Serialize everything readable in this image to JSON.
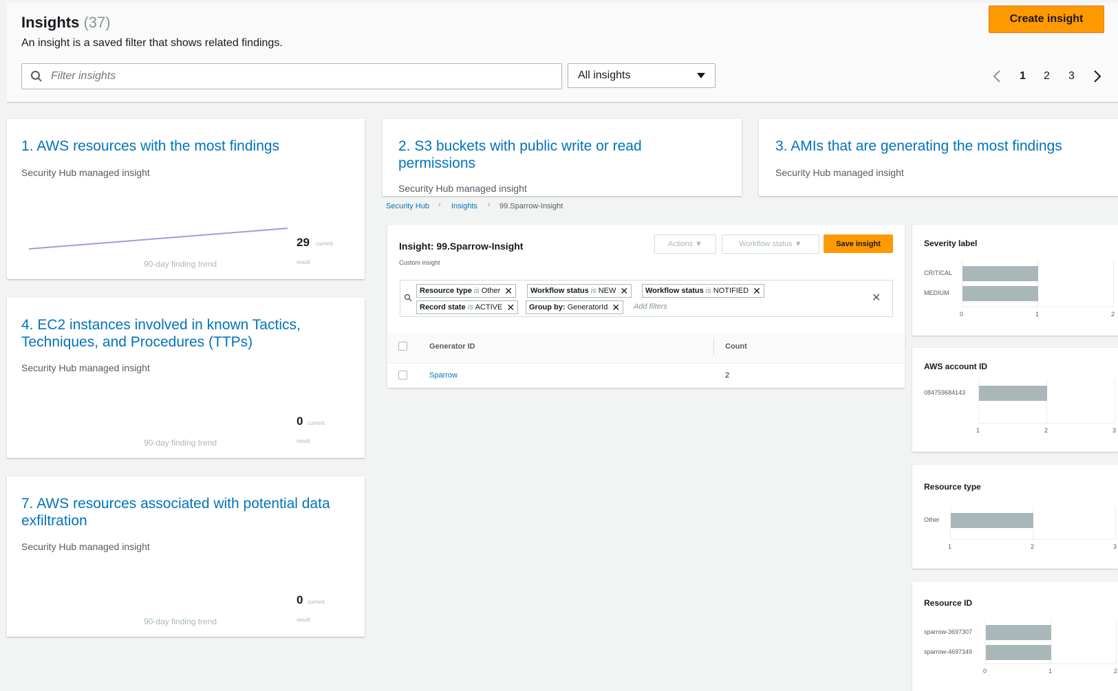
{
  "header": {
    "title": "Insights",
    "count": "(37)",
    "description": "An insight is a saved filter that shows related findings.",
    "create_button": "Create insight",
    "filter_placeholder": "Filter insights",
    "select_value": "All insights",
    "pages": [
      "1",
      "2",
      "3"
    ],
    "current_page": "1"
  },
  "cards": [
    {
      "title": "1. AWS resources with the most findings",
      "subtitle": "Security Hub managed insight",
      "count": "29",
      "count_label_top": "current",
      "count_label_bottom": "result",
      "trend_label": "90-day finding trend"
    },
    {
      "title": "2. S3 buckets with public write or read permissions",
      "subtitle": "Security Hub managed insight"
    },
    {
      "title": "3. AMIs that are generating the most findings",
      "subtitle": "Security Hub managed insight"
    },
    {
      "title": "4. EC2 instances involved in known Tactics, Techniques, and Procedures (TTPs)",
      "subtitle": "Security Hub managed insight",
      "count": "0",
      "count_label_top": "current",
      "count_label_bottom": "result",
      "trend_label": "90-day finding trend"
    },
    {
      "title": "7. AWS resources associated with potential data exfiltration",
      "subtitle": "Security Hub managed insight",
      "count": "0",
      "count_label_top": "current",
      "count_label_bottom": "result",
      "trend_label": "90-day finding trend"
    }
  ],
  "breadcrumb": {
    "items": [
      "Security Hub",
      "Insights",
      "99.Sparrow-Insight"
    ]
  },
  "insight_panel": {
    "title": "Insight: 99.Sparrow-Insight",
    "subtitle": "Custom insight",
    "actions_button": "Actions",
    "workflow_button": "Workflow status",
    "save_button": "Save insight",
    "filters": [
      {
        "key": "Resource type",
        "op": "is",
        "value": "Other"
      },
      {
        "key": "Workflow status",
        "op": "is",
        "value": "NEW"
      },
      {
        "key": "Workflow status",
        "op": "is",
        "value": "NOTIFIED"
      },
      {
        "key": "Record state",
        "op": "is",
        "value": "ACTIVE"
      },
      {
        "key": "Group by:",
        "op": "",
        "value": "GeneratorId"
      }
    ],
    "add_filters_placeholder": "Add filters",
    "columns": [
      "Generator ID",
      "Count"
    ],
    "rows": [
      {
        "generator_id": "Sparrow",
        "count": "2"
      }
    ]
  },
  "chart_data": [
    {
      "type": "bar",
      "title": "Severity label",
      "categories": [
        "CRITICAL",
        "MEDIUM"
      ],
      "values": [
        1,
        1
      ],
      "ticks": [
        "0",
        "1",
        "2"
      ],
      "xlim": [
        0,
        2
      ]
    },
    {
      "type": "bar",
      "title": "AWS account ID",
      "categories": [
        "084759684143"
      ],
      "values": [
        2
      ],
      "ticks": [
        "1",
        "2",
        "3"
      ],
      "xlim": [
        1,
        3
      ]
    },
    {
      "type": "bar",
      "title": "Resource type",
      "categories": [
        "Other"
      ],
      "values": [
        2
      ],
      "ticks": [
        "1",
        "2",
        "3"
      ],
      "xlim": [
        1,
        3
      ]
    },
    {
      "type": "bar",
      "title": "Resource ID",
      "categories": [
        "sparrow-3697307",
        "sparrow-4697349"
      ],
      "values": [
        1,
        1
      ],
      "ticks": [
        "0",
        "1",
        "2"
      ],
      "xlim": [
        0,
        2
      ]
    }
  ]
}
